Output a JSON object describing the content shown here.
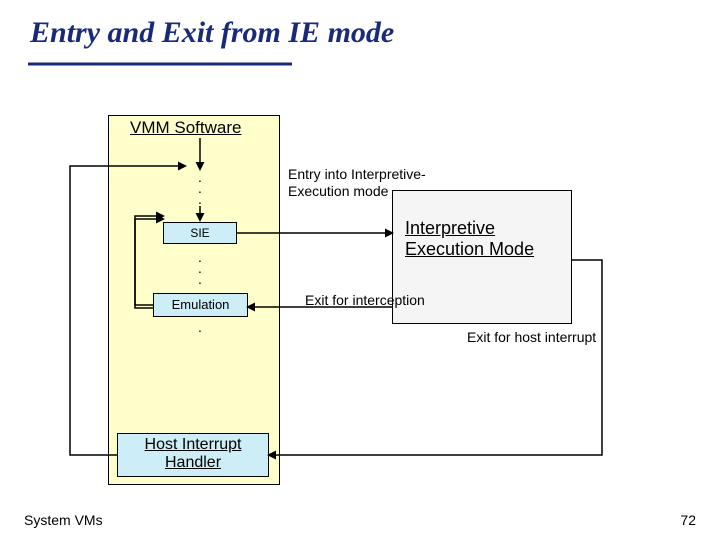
{
  "title": "Entry and Exit from IE mode",
  "footer": {
    "left": "System VMs",
    "pageNumber": "72"
  },
  "boxes": {
    "vmmTitle": "VMM Software",
    "sie": "SIE",
    "emulation": "Emulation",
    "hostHandlerLine1": "Host Interrupt",
    "hostHandlerLine2": "Handler",
    "iemLine1": "Interpretive",
    "iemLine2": "Execution Mode"
  },
  "labels": {
    "entry": "Entry into Interpretive-Execution mode",
    "exitInterception": "Exit for interception",
    "exitHostInterrupt": "Exit for host interrupt"
  }
}
